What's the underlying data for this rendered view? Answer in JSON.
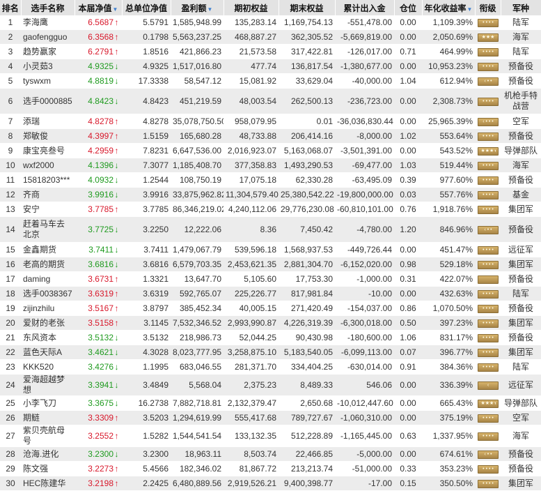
{
  "headers": {
    "rank": "排名",
    "name": "选手名称",
    "nav": "本届净值",
    "unit_nav": "总单位净值",
    "profit": "盈利额",
    "init_equity": "期初权益",
    "final_equity": "期末权益",
    "io": "累计出入金",
    "position": "仓位",
    "annual": "年化收益率",
    "grade": "衔级",
    "army": "军种"
  },
  "sort_arrow": "▼",
  "rows": [
    {
      "rank": "1",
      "name": "李海鹰",
      "nav": "6.5687",
      "dir": "up",
      "unit_nav": "5.5791",
      "profit": "1,585,948.99",
      "init": "135,283.14",
      "final": "1,169,754.13",
      "io": "-551,478.00",
      "pos": "0.00",
      "annual": "1,109.39%",
      "grade": "grade-badge",
      "pips": "• • • •",
      "army": "陆军"
    },
    {
      "rank": "2",
      "name": "gaofengguo",
      "nav": "6.3568",
      "dir": "up",
      "unit_nav": "0.1798",
      "profit": "5,563,237.25",
      "init": "468,887.27",
      "final": "362,305.52",
      "io": "-5,669,819.00",
      "pos": "0.00",
      "annual": "2,050.69%",
      "grade": "grade-badge",
      "pips": "★★★",
      "army": "海军"
    },
    {
      "rank": "3",
      "name": "趋势赢家",
      "nav": "6.2791",
      "dir": "up",
      "unit_nav": "1.8516",
      "profit": "421,866.23",
      "init": "21,573.58",
      "final": "317,422.81",
      "io": "-126,017.00",
      "pos": "0.71",
      "annual": "464.99%",
      "grade": "grade-badge",
      "pips": "• • • •",
      "army": "陆军"
    },
    {
      "rank": "4",
      "name": "小灵茹3",
      "nav": "4.9325",
      "dir": "down",
      "unit_nav": "4.9325",
      "profit": "1,517,016.80",
      "init": "477.74",
      "final": "136,817.54",
      "io": "-1,380,677.00",
      "pos": "0.00",
      "annual": "10,953.23%",
      "grade": "grade-badge",
      "pips": "• • • •",
      "army": "预备役"
    },
    {
      "rank": "5",
      "name": "tyswxm",
      "nav": "4.8819",
      "dir": "down",
      "unit_nav": "17.3338",
      "profit": "58,547.12",
      "init": "15,081.92",
      "final": "33,629.04",
      "io": "-40,000.00",
      "pos": "1.04",
      "annual": "612.94%",
      "grade": "grade-badge",
      "pips": "‹ • •",
      "army": "预备役"
    },
    {
      "rank": "6",
      "name": "选手0000885",
      "nav": "4.8423",
      "dir": "down",
      "unit_nav": "4.8423",
      "profit": "451,219.59",
      "init": "48,003.54",
      "final": "262,500.13",
      "io": "-236,723.00",
      "pos": "0.00",
      "annual": "2,308.73%",
      "grade": "grade-badge",
      "pips": "• • • •",
      "army": "机枪手特战营",
      "tall": true
    },
    {
      "rank": "7",
      "name": "添瑞",
      "nav": "4.8278",
      "dir": "up",
      "unit_nav": "4.8278",
      "profit": "35,078,750.50",
      "init": "958,079.95",
      "final": "0.01",
      "io": "-36,036,830.44",
      "pos": "0.00",
      "annual": "25,965.39%",
      "grade": "grade-badge",
      "pips": "‹ • • •",
      "army": "空军"
    },
    {
      "rank": "8",
      "name": "郑敏俊",
      "nav": "4.3997",
      "dir": "up",
      "unit_nav": "1.5159",
      "profit": "165,680.28",
      "init": "48,733.88",
      "final": "206,414.16",
      "io": "-8,000.00",
      "pos": "1.02",
      "annual": "553.64%",
      "grade": "grade-badge",
      "pips": "• • • •",
      "army": "预备役"
    },
    {
      "rank": "9",
      "name": "康宝亮叁号",
      "nav": "4.2959",
      "dir": "up",
      "unit_nav": "7.8231",
      "profit": "6,647,536.00",
      "init": "2,016,923.07",
      "final": "5,163,068.07",
      "io": "-3,501,391.00",
      "pos": "0.00",
      "annual": "543.52%",
      "grade": "grade-badge",
      "pips": "★★★★",
      "army": "导弹部队"
    },
    {
      "rank": "10",
      "name": "wxf2000",
      "nav": "4.1396",
      "dir": "down",
      "unit_nav": "7.3077",
      "profit": "1,185,408.70",
      "init": "377,358.83",
      "final": "1,493,290.53",
      "io": "-69,477.00",
      "pos": "1.03",
      "annual": "519.44%",
      "grade": "grade-badge",
      "pips": "• • • •",
      "army": "海军"
    },
    {
      "rank": "11",
      "name": "15818203***",
      "nav": "4.0932",
      "dir": "down",
      "unit_nav": "1.2544",
      "profit": "108,750.19",
      "init": "17,075.18",
      "final": "62,330.28",
      "io": "-63,495.09",
      "pos": "0.39",
      "annual": "977.60%",
      "grade": "grade-badge",
      "pips": "• • • •",
      "army": "预备役"
    },
    {
      "rank": "12",
      "name": "齐商",
      "nav": "3.9916",
      "dir": "down",
      "unit_nav": "3.9916",
      "profit": "33,875,962.82",
      "init": "11,304,579.40",
      "final": "25,380,542.22",
      "io": "-19,800,000.00",
      "pos": "0.03",
      "annual": "557.76%",
      "grade": "grade-badge",
      "pips": "• • • •",
      "army": "基金"
    },
    {
      "rank": "13",
      "name": "安宁",
      "nav": "3.7785",
      "dir": "up",
      "unit_nav": "3.7785",
      "profit": "86,346,219.02",
      "init": "4,240,112.06",
      "final": "29,776,230.08",
      "io": "-60,810,101.00",
      "pos": "0.76",
      "annual": "1,918.76%",
      "grade": "grade-badge",
      "pips": "• • • •",
      "army": "集团军"
    },
    {
      "rank": "14",
      "name": "赶着马车去北京",
      "nav": "3.7725",
      "dir": "down",
      "unit_nav": "3.2250",
      "profit": "12,222.06",
      "init": "8.36",
      "final": "7,450.42",
      "io": "-4,780.00",
      "pos": "1.20",
      "annual": "846.96%",
      "grade": "grade-badge",
      "pips": "‹ • •",
      "army": "预备役",
      "tall": true
    },
    {
      "rank": "15",
      "name": "金鑫期货",
      "nav": "3.7411",
      "dir": "down",
      "unit_nav": "3.7411",
      "profit": "1,479,067.79",
      "init": "539,596.18",
      "final": "1,568,937.53",
      "io": "-449,726.44",
      "pos": "0.00",
      "annual": "451.47%",
      "grade": "grade-badge",
      "pips": "• • • •",
      "army": "远征军"
    },
    {
      "rank": "16",
      "name": "老高的期货",
      "nav": "3.6816",
      "dir": "down",
      "unit_nav": "3.6816",
      "profit": "6,579,703.35",
      "init": "2,453,621.35",
      "final": "2,881,304.70",
      "io": "-6,152,020.00",
      "pos": "0.98",
      "annual": "529.18%",
      "grade": "grade-badge",
      "pips": "• • • •",
      "army": "集团军"
    },
    {
      "rank": "17",
      "name": "daming",
      "nav": "3.6731",
      "dir": "up",
      "unit_nav": "1.3321",
      "profit": "13,647.70",
      "init": "5,105.60",
      "final": "17,753.30",
      "io": "-1,000.00",
      "pos": "0.31",
      "annual": "422.07%",
      "grade": "grade-badge",
      "pips": "",
      "army": "预备役"
    },
    {
      "rank": "18",
      "name": "选手0038367",
      "nav": "3.6319",
      "dir": "up",
      "unit_nav": "3.6319",
      "profit": "592,765.07",
      "init": "225,226.77",
      "final": "817,981.84",
      "io": "-10.00",
      "pos": "0.00",
      "annual": "432.63%",
      "grade": "grade-badge",
      "pips": "• • • •",
      "army": "陆军"
    },
    {
      "rank": "19",
      "name": "zijinzhilu",
      "nav": "3.5167",
      "dir": "up",
      "unit_nav": "3.8797",
      "profit": "385,452.34",
      "init": "40,005.15",
      "final": "271,420.49",
      "io": "-154,037.00",
      "pos": "0.86",
      "annual": "1,070.50%",
      "grade": "grade-badge",
      "pips": "• • • •",
      "army": "预备役"
    },
    {
      "rank": "20",
      "name": "爱财的老张",
      "nav": "3.5158",
      "dir": "up",
      "unit_nav": "3.1145",
      "profit": "7,532,346.52",
      "init": "2,993,990.87",
      "final": "4,226,319.39",
      "io": "-6,300,018.00",
      "pos": "0.50",
      "annual": "397.23%",
      "grade": "grade-badge",
      "pips": "• • • •",
      "army": "集团军"
    },
    {
      "rank": "21",
      "name": "东风资本",
      "nav": "3.5132",
      "dir": "down",
      "unit_nav": "3.5132",
      "profit": "218,986.73",
      "init": "52,044.25",
      "final": "90,430.98",
      "io": "-180,600.00",
      "pos": "1.06",
      "annual": "831.17%",
      "grade": "grade-badge",
      "pips": "• • • •",
      "army": "预备役"
    },
    {
      "rank": "22",
      "name": "蓝色天际A",
      "nav": "3.4621",
      "dir": "down",
      "unit_nav": "4.3028",
      "profit": "8,023,777.95",
      "init": "3,258,875.10",
      "final": "5,183,540.05",
      "io": "-6,099,113.00",
      "pos": "0.07",
      "annual": "396.77%",
      "grade": "grade-badge",
      "pips": "• • • •",
      "army": "集团军"
    },
    {
      "rank": "23",
      "name": "KKK520",
      "nav": "3.4276",
      "dir": "down",
      "unit_nav": "1.1995",
      "profit": "683,046.55",
      "init": "281,371.70",
      "final": "334,404.25",
      "io": "-630,014.00",
      "pos": "0.91",
      "annual": "384.36%",
      "grade": "grade-badge",
      "pips": "• • • •",
      "army": "陆军"
    },
    {
      "rank": "24",
      "name": "爱海超越梦想",
      "nav": "3.3941",
      "dir": "down",
      "unit_nav": "3.4849",
      "profit": "5,568.04",
      "init": "2,375.23",
      "final": "8,489.33",
      "io": "546.06",
      "pos": "0.00",
      "annual": "336.39%",
      "grade": "grade-badge",
      "pips": "‹",
      "army": "远征军"
    },
    {
      "rank": "25",
      "name": "小李飞刀",
      "nav": "3.3675",
      "dir": "down",
      "unit_nav": "16.2738",
      "profit": "7,882,718.81",
      "init": "2,132,379.47",
      "final": "2,650.68",
      "io": "-10,012,447.60",
      "pos": "0.00",
      "annual": "665.43%",
      "grade": "grade-badge",
      "pips": "★★★★",
      "army": "导弹部队"
    },
    {
      "rank": "26",
      "name": "期鲢",
      "nav": "3.3309",
      "dir": "up",
      "unit_nav": "3.5203",
      "profit": "1,294,619.99",
      "init": "555,417.68",
      "final": "789,727.67",
      "io": "-1,060,310.00",
      "pos": "0.00",
      "annual": "375.19%",
      "grade": "grade-badge",
      "pips": "• • • •",
      "army": "空军"
    },
    {
      "rank": "27",
      "name": "紫贝壳航母号",
      "nav": "3.2552",
      "dir": "up",
      "unit_nav": "1.5282",
      "profit": "1,544,541.54",
      "init": "133,132.35",
      "final": "512,228.89",
      "io": "-1,165,445.00",
      "pos": "0.63",
      "annual": "1,337.95%",
      "grade": "grade-badge",
      "pips": "• • • •",
      "army": "海军"
    },
    {
      "rank": "28",
      "name": "沧海.进化",
      "nav": "3.2300",
      "dir": "down",
      "unit_nav": "3.2300",
      "profit": "18,963.11",
      "init": "8,503.74",
      "final": "22,466.85",
      "io": "-5,000.00",
      "pos": "0.00",
      "annual": "674.61%",
      "grade": "grade-badge",
      "pips": "‹ • •",
      "army": "预备役"
    },
    {
      "rank": "29",
      "name": "陈文强",
      "nav": "3.2273",
      "dir": "up",
      "unit_nav": "5.4566",
      "profit": "182,346.02",
      "init": "81,867.72",
      "final": "213,213.74",
      "io": "-51,000.00",
      "pos": "0.33",
      "annual": "353.23%",
      "grade": "grade-badge",
      "pips": "• • • •",
      "army": "预备役"
    },
    {
      "rank": "30",
      "name": "HEC陈建华",
      "nav": "3.2198",
      "dir": "up",
      "unit_nav": "2.2425",
      "profit": "6,480,889.56",
      "init": "2,919,526.21",
      "final": "9,400,398.77",
      "io": "-17.00",
      "pos": "0.15",
      "annual": "350.50%",
      "grade": "grade-badge",
      "pips": "• • • •",
      "army": "集团军"
    }
  ],
  "colors": {
    "up": "#d8182b",
    "down": "#1e9a1e",
    "header_bg": "#e3e3e3",
    "alt_row": "#ececec",
    "sort_arrow": "#3d7fd0"
  }
}
